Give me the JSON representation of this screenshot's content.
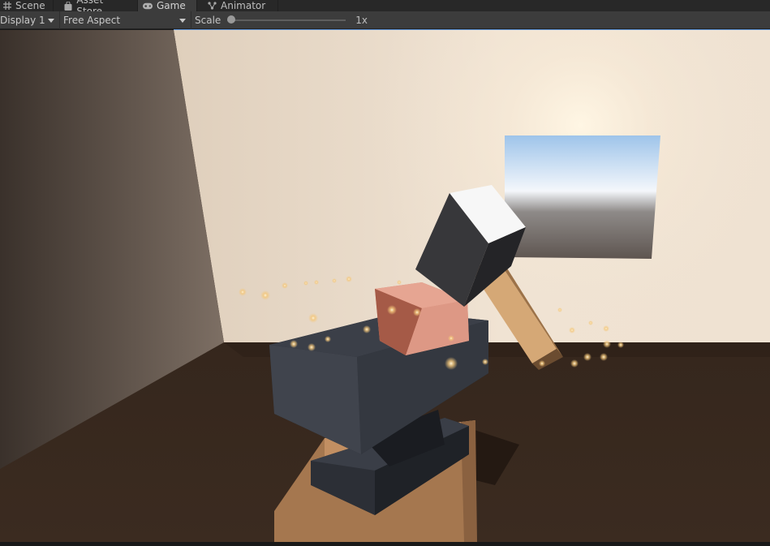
{
  "tabs": [
    {
      "id": "scene",
      "label": "Scene",
      "icon": "grid-icon"
    },
    {
      "id": "asset",
      "label": "Asset Store",
      "icon": "bag-icon"
    },
    {
      "id": "game",
      "label": "Game",
      "icon": "gamepad-icon",
      "active": true
    },
    {
      "id": "anim",
      "label": "Animator",
      "icon": "animator-icon"
    }
  ],
  "toolbar": {
    "display": "Display 1",
    "aspect": "Free Aspect",
    "scale_label": "Scale",
    "scale_value": "1x",
    "scale_fraction": 0
  },
  "colors": {
    "accent": "#5b8fd0",
    "tab_bg": "#282828",
    "tab_active": "#3c3c3c",
    "toolbar_bg": "#3c3c3c"
  }
}
